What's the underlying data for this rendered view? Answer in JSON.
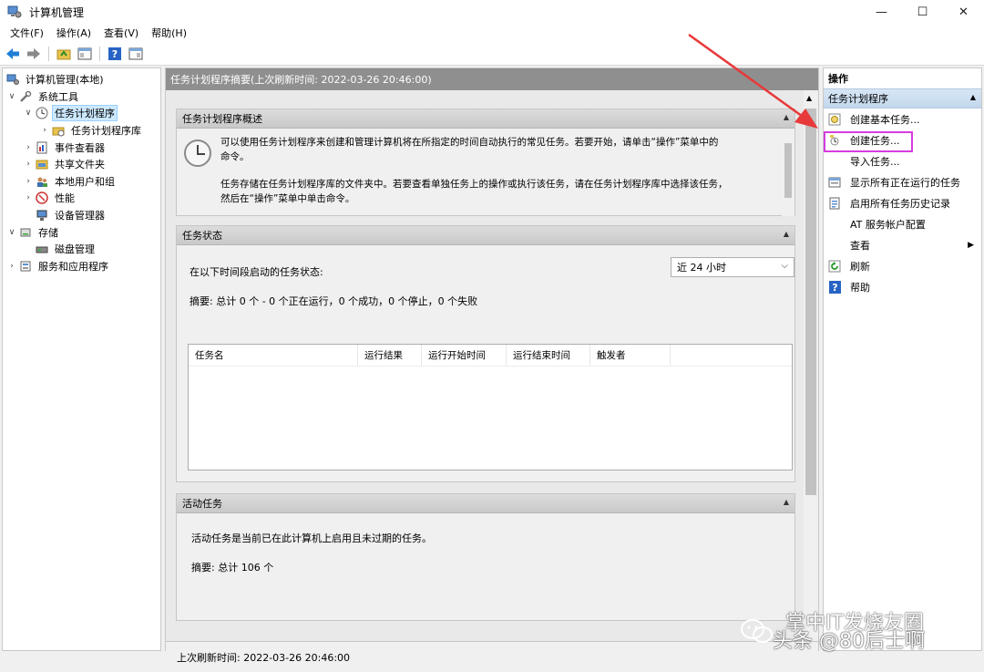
{
  "window": {
    "title": "计算机管理",
    "controls": [
      "—",
      "☐",
      "✕"
    ]
  },
  "menu": [
    "文件(F)",
    "操作(A)",
    "查看(V)",
    "帮助(H)"
  ],
  "tree": [
    {
      "label": "计算机管理(本地)",
      "icon": "computer-icon",
      "level": 0,
      "expander": ""
    },
    {
      "label": "系统工具",
      "icon": "tools-icon",
      "level": 1,
      "expander": "∨"
    },
    {
      "label": "任务计划程序",
      "icon": "clock-icon",
      "level": 2,
      "expander": "∨",
      "selected": true
    },
    {
      "label": "任务计划程序库",
      "icon": "folder-icon",
      "level": 3,
      "expander": "›"
    },
    {
      "label": "事件查看器",
      "icon": "event-viewer-icon",
      "level": 2,
      "expander": "›"
    },
    {
      "label": "共享文件夹",
      "icon": "shared-folder-icon",
      "level": 2,
      "expander": "›"
    },
    {
      "label": "本地用户和组",
      "icon": "users-icon",
      "level": 2,
      "expander": "›"
    },
    {
      "label": "性能",
      "icon": "performance-icon",
      "level": 2,
      "expander": "›"
    },
    {
      "label": "设备管理器",
      "icon": "device-manager-icon",
      "level": 2,
      "expander": ""
    },
    {
      "label": "存储",
      "icon": "storage-icon",
      "level": 1,
      "expander": "∨"
    },
    {
      "label": "磁盘管理",
      "icon": "disk-icon",
      "level": 2,
      "expander": ""
    },
    {
      "label": "服务和应用程序",
      "icon": "services-icon",
      "level": 1,
      "expander": "›"
    }
  ],
  "center": {
    "header": "任务计划程序摘要(上次刷新时间: 2022-03-26 20:46:00)",
    "overview": {
      "title": "任务计划程序概述",
      "para1_line1": "可以使用任务计划程序来创建和管理计算机将在所指定的时间自动执行的常见任务。若要开始，请单击“操作”菜单中的",
      "para1_line2": "命令。",
      "para2_line1": "任务存储在任务计划程序库的文件夹中。若要查看单独任务上的操作或执行该任务，请在任务计划程序库中选择该任务，",
      "para2_line2": "然后在“操作”菜单中单击命令。"
    },
    "status": {
      "title": "任务状态",
      "label": "在以下时间段启动的任务状态:",
      "period": "近 24 小时",
      "summary": "摘要: 总计 0 个 - 0 个正在运行，0 个成功，0 个停止，0 个失败",
      "columns": [
        "任务名",
        "运行结果",
        "运行开始时间",
        "运行结束时间",
        "触发者"
      ]
    },
    "active": {
      "title": "活动任务",
      "desc": "活动任务是当前已在此计算机上启用且未过期的任务。",
      "summary": "摘要: 总计 106 个"
    },
    "last_refresh": "上次刷新时间: 2022-03-26 20:46:00"
  },
  "actions": {
    "title": "操作",
    "group": "任务计划程序",
    "items": [
      {
        "label": "创建基本任务...",
        "icon": "basic-task-icon"
      },
      {
        "label": "创建任务...",
        "icon": "create-task-icon"
      },
      {
        "label": "导入任务...",
        "icon": ""
      },
      {
        "label": "显示所有正在运行的任务",
        "icon": "running-tasks-icon"
      },
      {
        "label": "启用所有任务历史记录",
        "icon": "history-icon"
      },
      {
        "label": "AT 服务帐户配置",
        "icon": ""
      },
      {
        "label": "查看",
        "icon": "",
        "submenu": true
      },
      {
        "label": "刷新",
        "icon": "refresh-icon"
      },
      {
        "label": "帮助",
        "icon": "help-icon"
      }
    ]
  },
  "watermark": {
    "line1": "掌中IT发烧友圈",
    "line2": "头条 @80后士啊"
  },
  "colors": {
    "highlight": "#d63de0",
    "arrow": "#e8393a",
    "selection": "#cce8ff",
    "header_gray": "#8f8f8f"
  }
}
